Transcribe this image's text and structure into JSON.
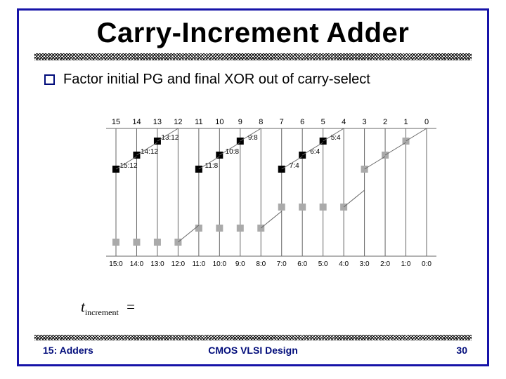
{
  "title": "Carry-Increment Adder",
  "bullet": "Factor initial PG and final XOR out of carry-select",
  "top_bits": [
    "15",
    "14",
    "13",
    "12",
    "11",
    "10",
    "9",
    "8",
    "7",
    "6",
    "5",
    "4",
    "3",
    "2",
    "1",
    "0"
  ],
  "bottom_labels": [
    "15:0",
    "14:0",
    "13:0",
    "12:0",
    "11:0",
    "10:0",
    "9:0",
    "8:0",
    "7:0",
    "6:0",
    "5:0",
    "4:0",
    "3:0",
    "2:0",
    "1:0",
    "0:0"
  ],
  "node_labels": {
    "g1_13_12": "13:12",
    "g1_9_8": "9:8",
    "g1_5_4": "5:4",
    "g2_14_12": "14:12",
    "g2_10_8": "10:8",
    "g2_6_4": "6:4",
    "g3_15_12": "15:12",
    "g3_11_8": "11:8",
    "g3_7_4": "7:4"
  },
  "equation": {
    "var": "t",
    "sub": "increment",
    "op": "="
  },
  "footer": {
    "left": "15: Adders",
    "center": "CMOS VLSI Design",
    "right": "30"
  }
}
